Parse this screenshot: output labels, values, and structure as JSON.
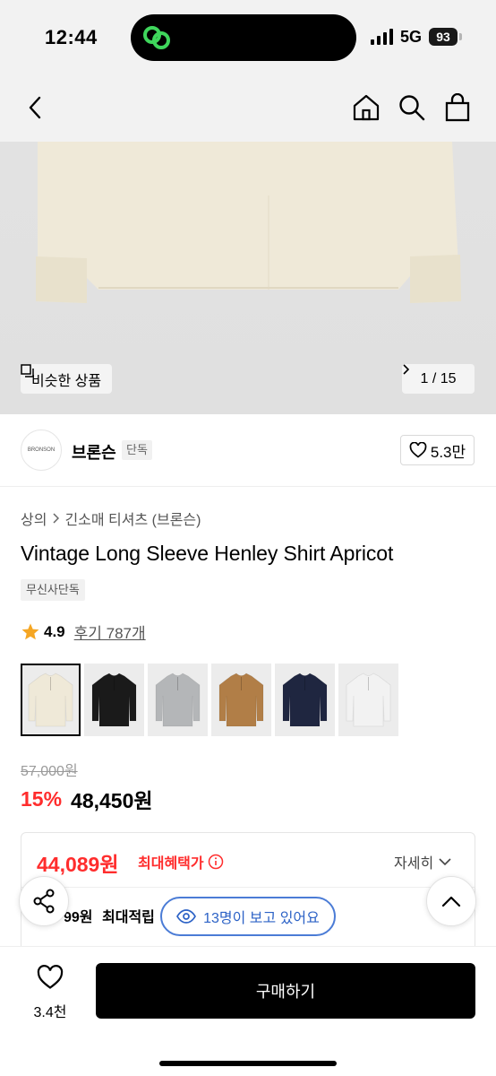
{
  "status": {
    "time": "12:44",
    "network": "5G",
    "battery": "93"
  },
  "nav": {
    "back": "back-arrow-icon",
    "home": "home-icon",
    "search": "search-icon",
    "cart": "shopping-bag-icon"
  },
  "hero": {
    "similar_label": "비슷한 상품",
    "page_indicator": "1 / 15"
  },
  "brand": {
    "name": "브론슨",
    "tag": "단독",
    "logo_text": "BRONSON",
    "likes": "5.3만"
  },
  "breadcrumb": {
    "level1": "상의",
    "level2": "긴소매 티셔츠 (브론슨)"
  },
  "product": {
    "title": "Vintage Long Sleeve Henley Shirt Apricot",
    "exclusive_tag": "무신사단독",
    "rating": "4.9",
    "reviews": "후기 787개",
    "original_price": "57,000원",
    "discount": "15%",
    "price": "48,450원"
  },
  "swatches": [
    {
      "name": "apricot",
      "color": "#efe9d8"
    },
    {
      "name": "black",
      "color": "#1a1a1a"
    },
    {
      "name": "grey",
      "color": "#b4b6b8"
    },
    {
      "name": "brown",
      "color": "#b17e47"
    },
    {
      "name": "navy",
      "color": "#1f2640"
    },
    {
      "name": "white",
      "color": "#f2f2f2"
    }
  ],
  "benefit": {
    "max_price": "44,089원",
    "max_label": "최대혜택가",
    "detail": "자세히",
    "points_partial": "99원",
    "points_label": "최대적립"
  },
  "viewers": "13명이 보고 있어요",
  "bottom": {
    "wish_count": "3.4천",
    "buy_label": "구매하기"
  },
  "colors": {
    "accent_red": "#ff2d2d",
    "accent_blue": "#2c62c6",
    "star": "#f5a623"
  }
}
